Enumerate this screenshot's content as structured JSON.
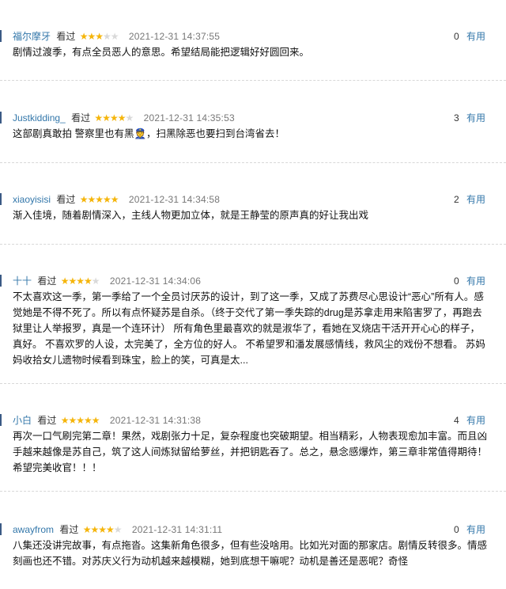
{
  "useful_label": "有用",
  "watched_label": "看过",
  "reviews": [
    {
      "user": "福尔摩牙",
      "rating": 3,
      "time": "2021-12-31 14:37:55",
      "useful": "0",
      "text": "剧情过渡季，有点全员恶人的意思。希望结局能把逻辑好好圆回来。"
    },
    {
      "user": "Justkidding_",
      "rating": 4,
      "time": "2021-12-31 14:35:53",
      "useful": "3",
      "text": "这部剧真敢拍 警察里也有黑👮，扫黑除恶也要扫到台湾省去！"
    },
    {
      "user": "xiaoyisisi",
      "rating": 5,
      "time": "2021-12-31 14:34:58",
      "useful": "2",
      "text": "渐入佳境，随着剧情深入，主线人物更加立体，就是王静莹的原声真的好让我出戏"
    },
    {
      "user": "十十",
      "rating": 4,
      "time": "2021-12-31 14:34:06",
      "useful": "0",
      "text": "不太喜欢这一季，第一季给了一个全员讨厌苏的设计，到了这一季，又成了苏费尽心思设计“恶心”所有人。感觉她是不得不死了。所以有点怀疑苏是自杀。（终于交代了第一季失踪的drug是苏拿走用来陷害罗了，再跑去狱里让人举报罗，真是一个连环计） 所有角色里最喜欢的就是淑华了，看她在叉烧店干活开开心心的样子，真好。 不喜欢罗的人设，太完美了，全方位的好人。 不希望罗和潘发展感情线，救风尘的戏份不想看。 苏妈妈收拾女儿遗物时候看到珠宝，脸上的笑，可真是太..."
    },
    {
      "user": "小白",
      "rating": 5,
      "time": "2021-12-31 14:31:38",
      "useful": "4",
      "text": "再次一口气刷完第二章！果然，戏剧张力十足，复杂程度也突破期望。相当精彩，人物表现愈加丰富。而且凶手越来越像是苏自己，筑了这人间炼狱留给萝丝，并把钥匙吞了。总之，悬念感爆炸，第三章非常值得期待！希望完美收官！！！"
    },
    {
      "user": "awayfrom",
      "rating": 4,
      "time": "2021-12-31 14:31:11",
      "useful": "0",
      "text": "八集还没讲完故事，有点拖沓。这集新角色很多，但有些没啥用。比如光对面的那家店。剧情反转很多。情感刻画也还不错。对苏庆义行为动机越来越模糊，她到底想干嘛呢？动机是善还是恶呢？奇怪"
    }
  ]
}
